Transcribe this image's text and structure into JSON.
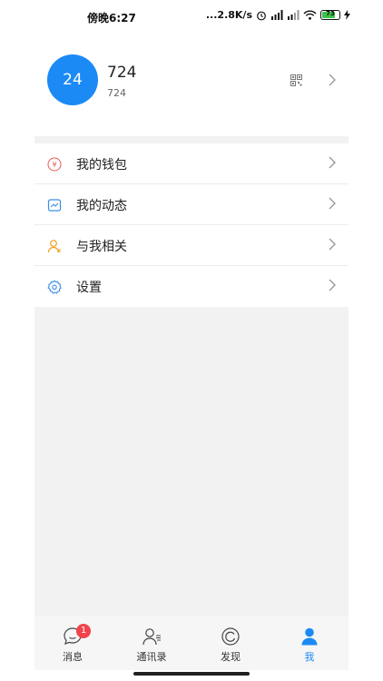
{
  "status_bar": {
    "time": "傍晚6:27",
    "network_speed": "...2.8K/s",
    "battery_level": "73"
  },
  "profile": {
    "avatar_text": "24",
    "name": "724",
    "user_id": "724"
  },
  "menu": {
    "items": [
      {
        "label": "我的钱包",
        "icon": "wallet-icon",
        "color": "#e85a55"
      },
      {
        "label": "我的动态",
        "icon": "moments-icon",
        "color": "#3a8ee6"
      },
      {
        "label": "与我相关",
        "icon": "related-user-icon",
        "color": "#f0a020"
      },
      {
        "label": "设置",
        "icon": "settings-gear-icon",
        "color": "#3a8ee6"
      }
    ]
  },
  "tabbar": {
    "tabs": [
      {
        "label": "消息",
        "icon": "chat-bubble-icon",
        "badge": "1"
      },
      {
        "label": "通讯录",
        "icon": "contacts-icon"
      },
      {
        "label": "发现",
        "icon": "discover-icon"
      },
      {
        "label": "我",
        "icon": "me-person-icon",
        "active": true
      }
    ]
  },
  "colors": {
    "accent": "#1c8af4",
    "badge": "#f2434c",
    "background": "#f2f2f2"
  }
}
